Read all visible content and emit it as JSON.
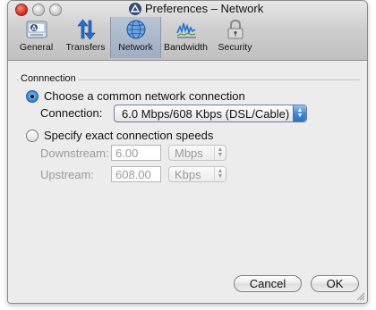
{
  "window": {
    "title": "Preferences – Network"
  },
  "toolbar": {
    "items": [
      {
        "label": "General",
        "icon": "general-icon"
      },
      {
        "label": "Transfers",
        "icon": "transfers-icon"
      },
      {
        "label": "Network",
        "icon": "network-globe-icon",
        "selected": true
      },
      {
        "label": "Bandwidth",
        "icon": "bandwidth-icon"
      },
      {
        "label": "Security",
        "icon": "padlock-icon"
      }
    ]
  },
  "connection": {
    "group_label": "Connnection",
    "option_common": "Choose a common network connection",
    "option_common_selected": true,
    "connection_label": "Connection:",
    "connection_value": "6.0 Mbps/608 Kbps (DSL/Cable)",
    "option_specify": "Specify exact connection speeds",
    "downstream_label": "Downstream:",
    "downstream_value": "6.00",
    "downstream_unit": "Mbps",
    "upstream_label": "Upstream:",
    "upstream_value": "608.00",
    "upstream_unit": "Kbps"
  },
  "buttons": {
    "cancel": "Cancel",
    "ok": "OK"
  },
  "colors": {
    "accent": "#3c86dc",
    "selected_tab": "#a9b6c8"
  }
}
